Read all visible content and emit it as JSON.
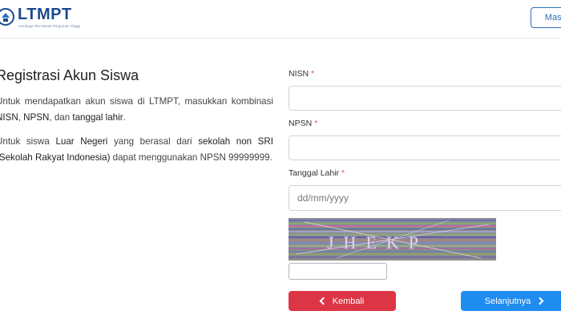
{
  "header": {
    "logo_text": "LTMPT",
    "logo_subtitle": "Lembaga Tes Masuk Perguruan Tinggi",
    "login_label": "Masuk"
  },
  "intro": {
    "title": "Registrasi Akun Siswa",
    "p1": {
      "t1": "Untuk mendapatkan akun siswa di LTMPT, masukkan kombinasi ",
      "b1": "NISN",
      "t2": ", ",
      "b2": "NPSN",
      "t3": ", dan ",
      "b3": "tanggal lahir",
      "t4": "."
    },
    "p2": {
      "t1": "Untuk siswa ",
      "b1": "Luar Negeri",
      "t2": " yang berasal dari ",
      "b2": "sekolah non SRI (Sekolah Rakyat Indonesia)",
      "t3": " dapat menggunakan NPSN 99999999."
    }
  },
  "form": {
    "required_mark": "*",
    "nisn_label": "NISN",
    "npsn_label": "NPSN",
    "birthdate_label": "Tanggal Lahir",
    "birthdate_placeholder": "dd/mm/yyyy",
    "captcha_text": "JHEKP",
    "back_label": "Kembali",
    "next_label": "Selanjutnya"
  },
  "colors": {
    "brand": "#1b4a8f",
    "back_button": "#dc3545",
    "next_button": "#1f8cf0",
    "required": "#d9534f"
  },
  "icons": {
    "logo": "ltmpt-emblem-icon",
    "back": "chevron-left-icon",
    "next": "chevron-right-icon"
  }
}
